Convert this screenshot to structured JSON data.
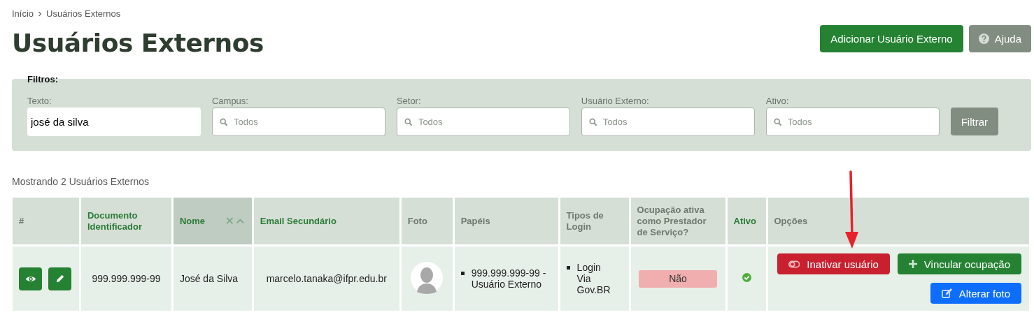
{
  "breadcrumb": [
    "Início",
    "Usuários Externos"
  ],
  "title": "Usuários Externos",
  "actions": [
    {
      "label": "Adicionar Usuário Externo",
      "kind": "add"
    },
    {
      "label": "Ajuda",
      "kind": "help"
    }
  ],
  "filters": {
    "title": "Filtros:",
    "fields": [
      {
        "label": "Texto:",
        "kind": "text",
        "value": "josé da silva"
      },
      {
        "label": "Campus:",
        "kind": "select",
        "placeholder": "Todos"
      },
      {
        "label": "Setor:",
        "kind": "select",
        "placeholder": "Todos"
      },
      {
        "label": "Usuário Externo:",
        "kind": "select",
        "placeholder": "Todos"
      },
      {
        "label": "Ativo:",
        "kind": "select",
        "placeholder": "Todos"
      }
    ],
    "button": "Filtrar"
  },
  "summary": "Mostrando 2 Usuários Externos",
  "table": {
    "columns": [
      {
        "label": "#",
        "sortable": false,
        "sorted": false
      },
      {
        "label": "Documento Identificador",
        "sortable": true,
        "sorted": false
      },
      {
        "label": "Nome",
        "sortable": true,
        "sorted": true
      },
      {
        "label": "Email Secundário",
        "sortable": true,
        "sorted": false
      },
      {
        "label": "Foto",
        "sortable": false,
        "sorted": false
      },
      {
        "label": "Papéis",
        "sortable": false,
        "sorted": false
      },
      {
        "label": "Tipos de Login",
        "sortable": false,
        "sorted": false
      },
      {
        "label": "Ocupação ativa como Prestador de Serviço?",
        "sortable": false,
        "sorted": false
      },
      {
        "label": "Ativo",
        "sortable": true,
        "sorted": false
      },
      {
        "label": "Opções",
        "sortable": false,
        "sorted": false
      }
    ],
    "rows": [
      {
        "documento": "999.999.999-99",
        "nome": "José da Silva",
        "email": "marcelo.tanaka@ifpr.edu.br",
        "papeis": [
          "999.999.999-99 - Usuário Externo"
        ],
        "tipos_login": [
          "Login Via Gov.BR"
        ],
        "ocupacao": "Não",
        "ativo": true,
        "options": [
          {
            "label": "Inativar usuário",
            "kind": "deactivate"
          },
          {
            "label": "Vincular ocupação",
            "kind": "link"
          },
          {
            "label": "Alterar foto",
            "kind": "photo"
          }
        ]
      }
    ]
  }
}
